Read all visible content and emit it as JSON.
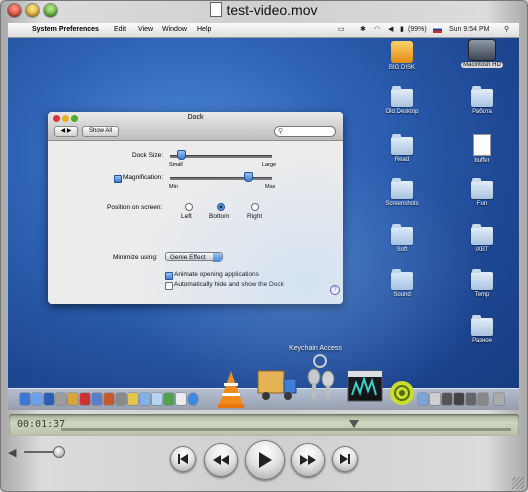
{
  "window": {
    "title": "test-video.mov"
  },
  "menubar": {
    "app": "System Preferences",
    "items": [
      "Edit",
      "View",
      "Window",
      "Help"
    ],
    "battery": "(99%)",
    "clock": "Sun 9:54 PM"
  },
  "desktop_icons": [
    {
      "label": "BIG DISK",
      "kind": "disk"
    },
    {
      "label": "Macintosh HD",
      "kind": "hd"
    },
    {
      "label": "Old Desktop",
      "kind": "folder"
    },
    {
      "label": "Работа",
      "kind": "folder"
    },
    {
      "label": "Read",
      "kind": "folder"
    },
    {
      "label": "buffer",
      "kind": "doc"
    },
    {
      "label": "Screenshots",
      "kind": "folder"
    },
    {
      "label": "Fun",
      "kind": "folder"
    },
    {
      "label": "Soft",
      "kind": "folder"
    },
    {
      "label": "iXBT",
      "kind": "folder"
    },
    {
      "label": "Sound",
      "kind": "folder"
    },
    {
      "label": "Temp",
      "kind": "folder"
    },
    {
      "label": "Разное",
      "kind": "folder"
    }
  ],
  "prefs": {
    "title": "Dock",
    "show_all": "Show All",
    "dock_size_label": "Dock Size:",
    "small": "Small",
    "large": "Large",
    "dock_size_value": 0.1,
    "magnification_label": "Magnification:",
    "magnification_checked": true,
    "min": "Min",
    "max": "Max",
    "magnification_value": 0.75,
    "position_label": "Position on screen:",
    "positions": [
      "Left",
      "Bottom",
      "Right"
    ],
    "position_selected": "Bottom",
    "minimize_label": "Minimize using:",
    "minimize_value": "Genie Effect",
    "animate_label": "Animate opening applications",
    "animate_checked": true,
    "autohide_label": "Automatically hide and show the Dock",
    "autohide_checked": false,
    "help": "?"
  },
  "dock": {
    "tooltip": "Keychain Access"
  },
  "player": {
    "time": "00:01:37",
    "progress": 0.65,
    "volume": 0.85
  }
}
